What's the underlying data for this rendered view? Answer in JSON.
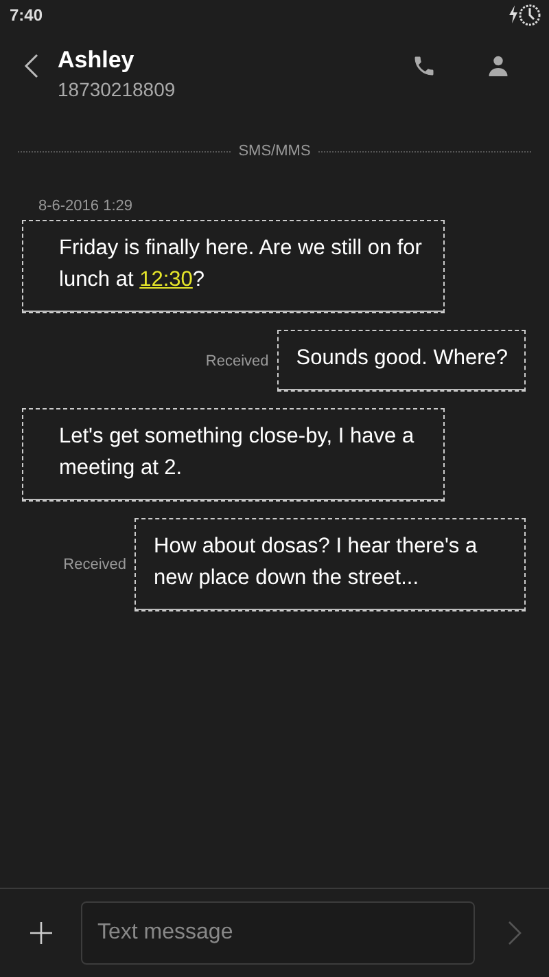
{
  "status_bar": {
    "time": "7:40"
  },
  "header": {
    "name": "Ashley",
    "number": "18730218809"
  },
  "divider_label": "SMS/MMS",
  "timestamp": "8-6-2016 1:29",
  "messages": [
    {
      "kind": "sent",
      "parts": [
        {
          "text": "Friday is finally here. Are we still on for lunch at ",
          "link": false
        },
        {
          "text": "12:30",
          "link": true
        },
        {
          "text": "?",
          "link": false
        }
      ]
    },
    {
      "kind": "received",
      "status": "Received",
      "parts": [
        {
          "text": "Sounds good. Where?",
          "link": false
        }
      ]
    },
    {
      "kind": "sent",
      "parts": [
        {
          "text": "Let's get something close-by, I have a meeting at 2.",
          "link": false
        }
      ]
    },
    {
      "kind": "received",
      "status": "Received",
      "parts": [
        {
          "text": "How about dosas? I hear there's a new place down the street...",
          "link": false
        }
      ]
    }
  ],
  "composer": {
    "placeholder": "Text message"
  }
}
